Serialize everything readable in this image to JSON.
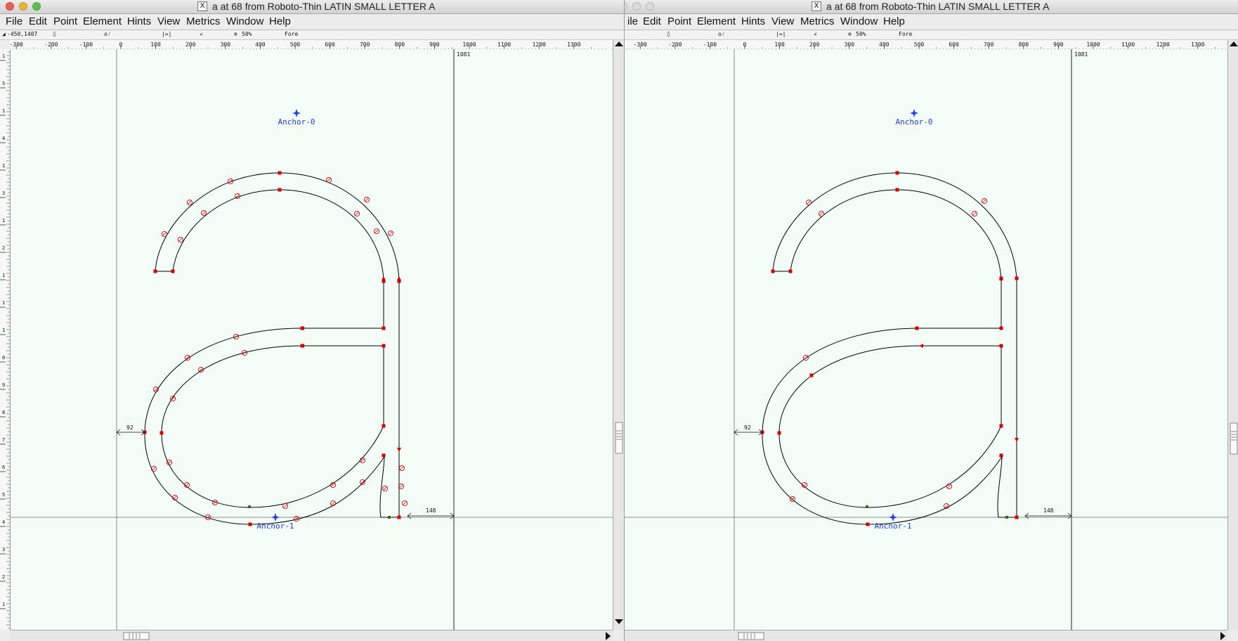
{
  "left_window": {
    "title": "a at 68 from Roboto-Thin LATIN SMALL LETTER A",
    "x_icon": "X",
    "menu": [
      "File",
      "Edit",
      "Point",
      "Element",
      "Hints",
      "View",
      "Metrics",
      "Window",
      "Help"
    ],
    "info": {
      "coords": "-450,1407",
      "zoom": "50%",
      "layer": "Fore"
    },
    "icons": [
      "arrow-icon",
      "pointer-diamond-icon",
      "ruler-icon",
      "width-icon",
      "angle-icon",
      "zoom-icon"
    ]
  },
  "right_window": {
    "title": "a at 68 from Roboto-Thin LATIN SMALL LETTER A",
    "x_icon": "X",
    "menu": [
      "ile",
      "Edit",
      "Point",
      "Element",
      "Hints",
      "View",
      "Metrics",
      "Window",
      "Help"
    ],
    "info": {
      "zoom": "50%",
      "layer": "Fore"
    },
    "icons": [
      "pointer-diamond-icon",
      "ruler-icon",
      "width-icon",
      "angle-icon",
      "zoom-icon"
    ]
  },
  "ruler": {
    "labels_left": [
      "-300",
      "-200",
      "-100",
      "0",
      "100",
      "200",
      "300",
      "400",
      "500",
      "600",
      "700",
      "800",
      "900",
      "1000",
      "1100",
      "1200",
      "1300"
    ],
    "labels_right": [
      "-300",
      "-200",
      "-100",
      "0",
      "100",
      "200",
      "300",
      "400",
      "500",
      "600",
      "700",
      "800",
      "900",
      "1000",
      "1100",
      "1200",
      "1300"
    ],
    "v_digits": [
      "1",
      "5",
      "1",
      "4",
      "1",
      "3",
      "1",
      "2",
      "1",
      "1",
      "1",
      "0",
      "9",
      "8",
      "7",
      "6",
      "5",
      "4",
      "3",
      "2",
      "1"
    ]
  },
  "glyph": {
    "advance_width": "1081",
    "left_bearing": "92",
    "right_bearing": "148",
    "anchors": [
      "Anchor-0",
      "Anchor-1"
    ]
  },
  "colors": {
    "canvas_bg": "#f3fcf7",
    "outline": "#000000",
    "point": "#d40000",
    "anchor": "#1f3fd6",
    "guide": "#6a6a6a"
  }
}
